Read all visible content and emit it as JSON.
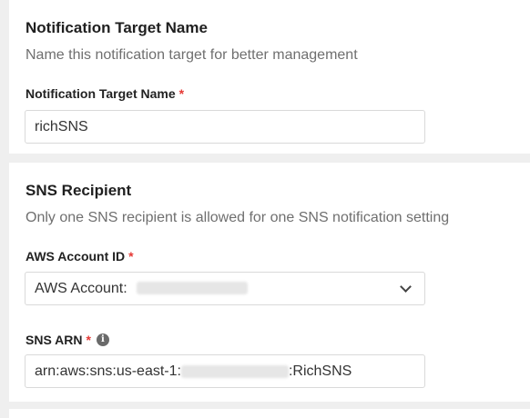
{
  "name_section": {
    "title": "Notification Target Name",
    "description": "Name this notification target for better management",
    "field_label": "Notification Target Name",
    "required_mark": "*",
    "value": "richSNS"
  },
  "recipient_section": {
    "title": "SNS Recipient",
    "description": "Only one SNS recipient is allowed for one SNS notification setting",
    "account_label": "AWS Account ID",
    "account_required_mark": "*",
    "account_value_prefix": "AWS Account:",
    "account_icon": "chevron-down-icon",
    "arn_label": "SNS ARN",
    "arn_required_mark": "*",
    "arn_info_icon": "info-icon",
    "arn_info_glyph": "i",
    "arn_value_prefix": "arn:aws:sns:us-east-1:",
    "arn_value_suffix": ":RichSNS"
  },
  "colors": {
    "required": "#e53935",
    "page_background": "#efefef",
    "card_background": "#ffffff",
    "input_border": "#d9d9d9"
  }
}
